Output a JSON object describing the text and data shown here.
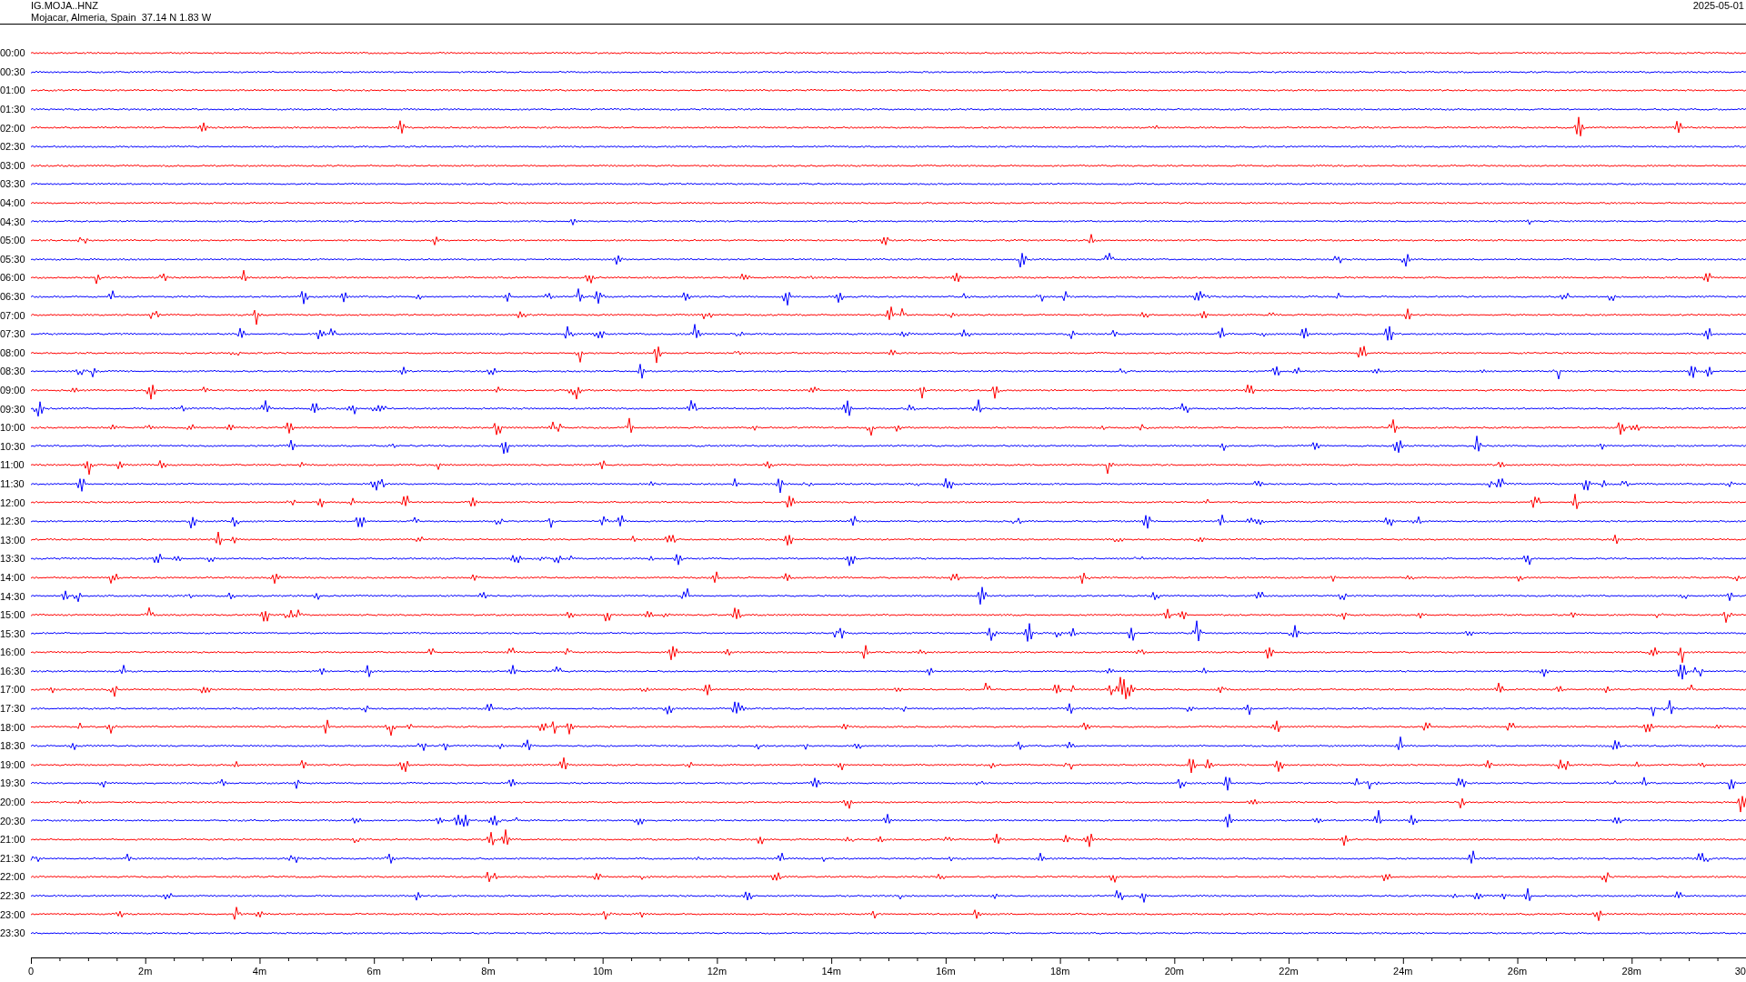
{
  "header": {
    "station": "IG.MOJA..HNZ",
    "location": "Mojacar, Almeria, Spain  37.14 N 1.83 W",
    "date": "2025-05-01"
  },
  "traces": [
    {
      "label": "00:00",
      "color": "#ff0000"
    },
    {
      "label": "00:30",
      "color": "#0000ff"
    },
    {
      "label": "01:00",
      "color": "#ff0000"
    },
    {
      "label": "01:30",
      "color": "#0000ff"
    },
    {
      "label": "02:00",
      "color": "#ff0000"
    },
    {
      "label": "02:30",
      "color": "#0000ff"
    },
    {
      "label": "03:00",
      "color": "#ff0000"
    },
    {
      "label": "03:30",
      "color": "#0000ff"
    },
    {
      "label": "04:00",
      "color": "#ff0000"
    },
    {
      "label": "04:30",
      "color": "#0000ff"
    },
    {
      "label": "05:00",
      "color": "#ff0000"
    },
    {
      "label": "05:30",
      "color": "#0000ff"
    },
    {
      "label": "06:00",
      "color": "#ff0000"
    },
    {
      "label": "06:30",
      "color": "#0000ff"
    },
    {
      "label": "07:00",
      "color": "#ff0000"
    },
    {
      "label": "07:30",
      "color": "#0000ff"
    },
    {
      "label": "08:00",
      "color": "#ff0000"
    },
    {
      "label": "08:30",
      "color": "#0000ff"
    },
    {
      "label": "09:00",
      "color": "#ff0000"
    },
    {
      "label": "09:30",
      "color": "#0000ff"
    },
    {
      "label": "10:00",
      "color": "#ff0000"
    },
    {
      "label": "10:30",
      "color": "#0000ff"
    },
    {
      "label": "11:00",
      "color": "#ff0000"
    },
    {
      "label": "11:30",
      "color": "#0000ff"
    },
    {
      "label": "12:00",
      "color": "#ff0000"
    },
    {
      "label": "12:30",
      "color": "#0000ff"
    },
    {
      "label": "13:00",
      "color": "#ff0000"
    },
    {
      "label": "13:30",
      "color": "#0000ff"
    },
    {
      "label": "14:00",
      "color": "#ff0000"
    },
    {
      "label": "14:30",
      "color": "#0000ff"
    },
    {
      "label": "15:00",
      "color": "#ff0000"
    },
    {
      "label": "15:30",
      "color": "#0000ff"
    },
    {
      "label": "16:00",
      "color": "#ff0000"
    },
    {
      "label": "16:30",
      "color": "#0000ff"
    },
    {
      "label": "17:00",
      "color": "#ff0000"
    },
    {
      "label": "17:30",
      "color": "#0000ff"
    },
    {
      "label": "18:00",
      "color": "#ff0000"
    },
    {
      "label": "18:30",
      "color": "#0000ff"
    },
    {
      "label": "19:00",
      "color": "#ff0000"
    },
    {
      "label": "19:30",
      "color": "#0000ff"
    },
    {
      "label": "20:00",
      "color": "#ff0000"
    },
    {
      "label": "20:30",
      "color": "#0000ff"
    },
    {
      "label": "21:00",
      "color": "#ff0000"
    },
    {
      "label": "21:30",
      "color": "#0000ff"
    },
    {
      "label": "22:00",
      "color": "#ff0000"
    },
    {
      "label": "22:30",
      "color": "#0000ff"
    },
    {
      "label": "23:00",
      "color": "#ff0000"
    },
    {
      "label": "23:30",
      "color": "#0000ff"
    }
  ],
  "axis": {
    "ticks": [
      "0",
      "2m",
      "4m",
      "6m",
      "8m",
      "10m",
      "12m",
      "14m",
      "16m",
      "18m",
      "20m",
      "22m",
      "24m",
      "26m",
      "28m",
      "30"
    ]
  }
}
